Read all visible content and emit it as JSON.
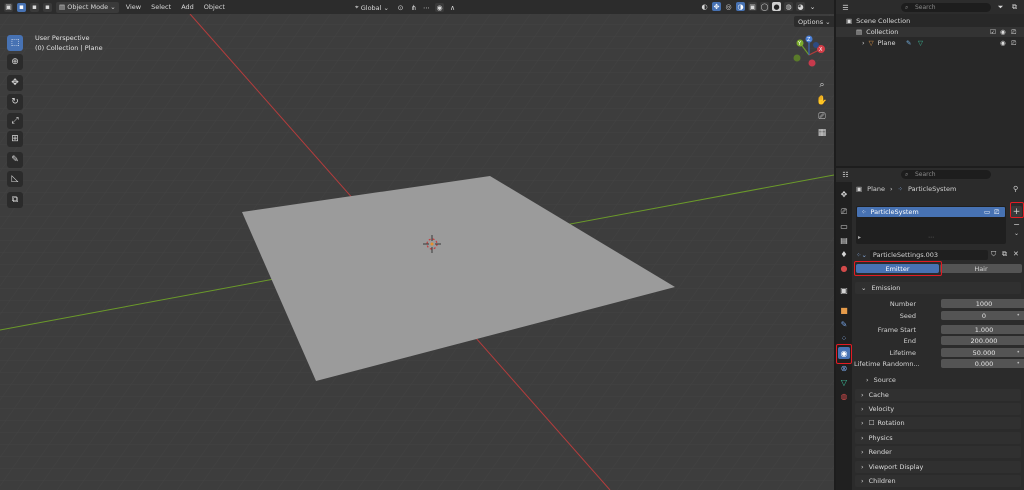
{
  "viewport": {
    "header": {
      "mode": "Object Mode",
      "menus": [
        "View",
        "Select",
        "Add",
        "Object"
      ],
      "orientation": "Global",
      "options": "Options"
    },
    "perspective": "User Perspective",
    "collection_info": "(0) Collection | Plane",
    "tools": [
      "select-box-icon",
      "cursor-icon",
      "move-icon",
      "rotate-icon",
      "scale-icon",
      "transform-icon",
      "annotate-icon",
      "measure-icon",
      "add-cube-icon"
    ],
    "gizmo": {
      "x": "X",
      "y": "Y",
      "z": "Z"
    }
  },
  "outliner": {
    "search_placeholder": "Search",
    "scene_collection": "Scene Collection",
    "collection": "Collection",
    "object": "Plane"
  },
  "properties": {
    "search_placeholder": "Search",
    "breadcrumb": {
      "object": "Plane",
      "system": "ParticleSystem"
    },
    "particle_list": {
      "item": "ParticleSystem"
    },
    "settings_name": "ParticleSettings.003",
    "type_tabs": {
      "emitter": "Emitter",
      "hair": "Hair"
    },
    "emission": {
      "title": "Emission",
      "number_label": "Number",
      "number": "1000",
      "seed_label": "Seed",
      "seed": "0",
      "frame_start_label": "Frame Start",
      "frame_start": "1.000",
      "end_label": "End",
      "end": "200.000",
      "lifetime_label": "Lifetime",
      "lifetime": "50.000",
      "lifetime_rand_label": "Lifetime Randomn...",
      "lifetime_rand": "0.000",
      "source": "Source"
    },
    "panels": [
      "Cache",
      "Velocity",
      "Rotation",
      "Physics",
      "Render",
      "Viewport Display",
      "Children"
    ]
  },
  "colors": {
    "accent": "#4772b3",
    "highlight": "#e31b23",
    "plane": "#9b9b9b",
    "x_axis": "#b43c3c",
    "y_axis": "#6b9a2a"
  }
}
